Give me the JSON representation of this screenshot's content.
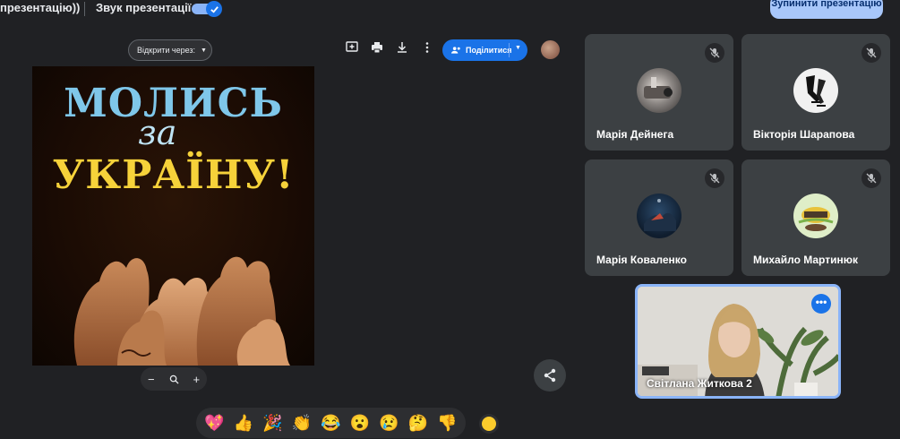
{
  "topbar": {
    "presentation_title": "презентацію))",
    "sound_label": "Звук презентації",
    "sound_enabled": true,
    "stop_button": "Зупинити презентацію"
  },
  "presentation": {
    "open_with_label": "Відкрити через:",
    "toolbar_icons": [
      "add-comment-icon",
      "print-icon",
      "download-icon",
      "more-vert-icon"
    ],
    "share_label": "Поділитися",
    "poster": {
      "line1": "МОЛИСЬ",
      "line2": "за",
      "line3": "УКРАЇНУ!"
    },
    "zoom": {
      "minus": "−",
      "plus": "+"
    }
  },
  "participants": [
    {
      "name": "Марія Дейнега",
      "muted": true
    },
    {
      "name": "Вікторія Шарапова",
      "muted": true
    },
    {
      "name": "Марія Коваленко",
      "muted": true
    },
    {
      "name": "Михайло Мартинюк",
      "muted": true
    }
  ],
  "active_speaker": {
    "name": "Світлана Житкова 2",
    "more": "•••"
  },
  "reactions": [
    "💖",
    "👍",
    "🎉",
    "👏",
    "😂",
    "😮",
    "😢",
    "🤔",
    "👎"
  ],
  "colors": {
    "accent": "#1a73e8",
    "stop_button_bg": "#a8c7fa",
    "speaker_border": "#8ab4f8"
  }
}
